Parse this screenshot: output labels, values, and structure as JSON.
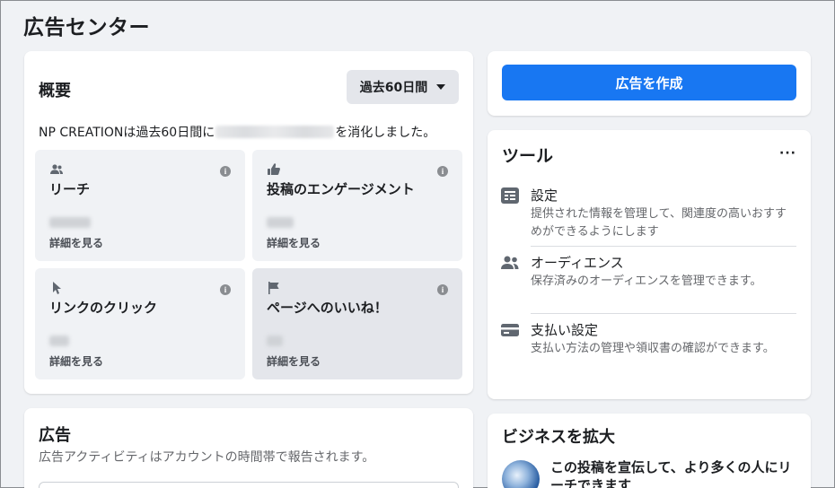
{
  "page": {
    "title": "広告センター"
  },
  "overview": {
    "title": "概要",
    "range_label": "過去60日間",
    "spend_prefix": "NP CREATIONは過去60日間に",
    "spend_suffix": "を消化しました。",
    "metrics": [
      {
        "label": "リーチ",
        "link": "詳細を見る",
        "icon": "people-icon"
      },
      {
        "label": "投稿のエンゲージメント",
        "link": "詳細を見る",
        "icon": "thumbs-up-icon"
      },
      {
        "label": "リンクのクリック",
        "link": "詳細を見る",
        "icon": "cursor-icon"
      },
      {
        "label": "ページへのいいね！",
        "link": "詳細を見る",
        "icon": "flag-icon"
      }
    ]
  },
  "create": {
    "label": "広告を作成"
  },
  "tools": {
    "title": "ツール",
    "more": "···",
    "items": [
      {
        "title": "設定",
        "desc": "提供された情報を管理して、関連度の高いおすすめができるようにします",
        "icon": "settings-doc-icon"
      },
      {
        "title": "オーディエンス",
        "desc": "保存済みのオーディエンスを管理できます。",
        "icon": "audience-icon"
      },
      {
        "title": "支払い設定",
        "desc": "支払い方法の管理や領収書の確認ができます。",
        "icon": "credit-card-icon"
      }
    ]
  },
  "ads": {
    "title": "広告",
    "subtitle": "広告アクティビティはアカウントの時間帯で報告されます。"
  },
  "grow": {
    "title": "ビジネスを拡大",
    "promo_text": "この投稿を宣伝して、より多くの人にリーチできます"
  },
  "colors": {
    "primary": "#1877f2",
    "background": "#f0f2f5",
    "card": "#ffffff"
  }
}
